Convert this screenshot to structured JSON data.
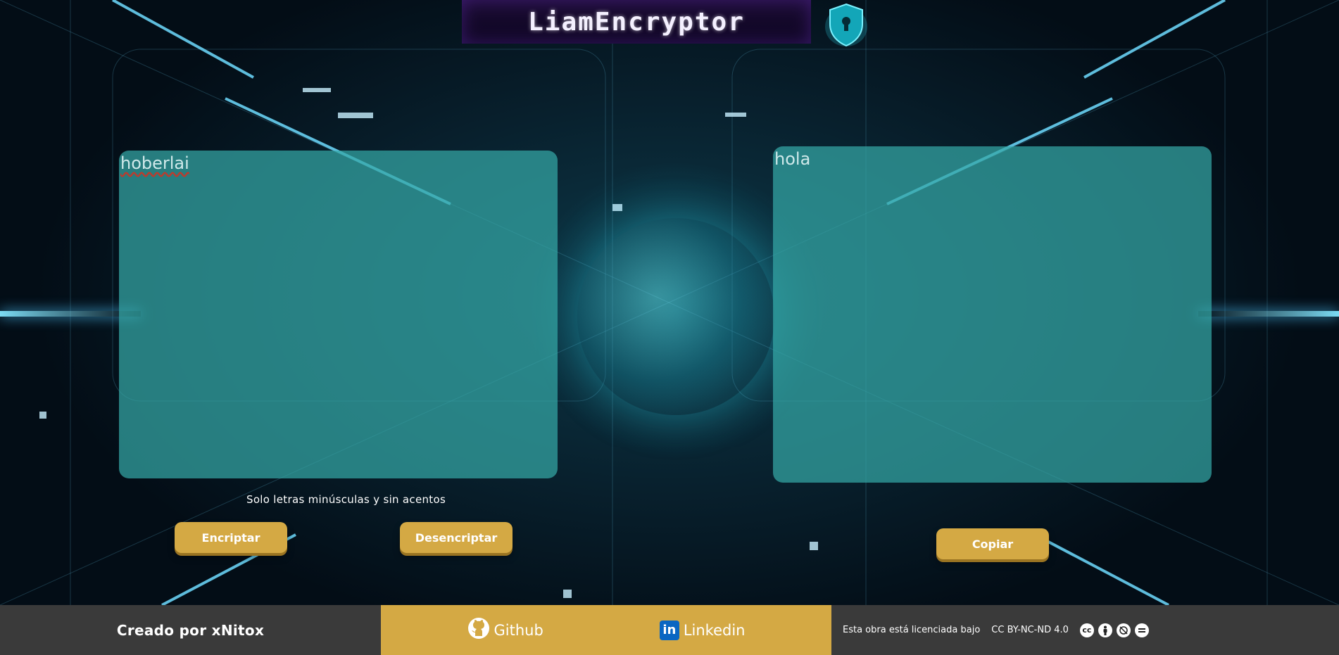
{
  "header": {
    "title": "LiamEncryptor",
    "logo_icon": "shield-lock-icon"
  },
  "input_panel": {
    "value": "hoberlai",
    "hint": "Solo letras minúsculas y sin acentos"
  },
  "output_panel": {
    "value": "hola"
  },
  "buttons": {
    "encrypt": "Encriptar",
    "decrypt": "Desencriptar",
    "copy": "Copiar"
  },
  "footer": {
    "credit": "Creado por xNitox",
    "github_label": "Github",
    "linkedin_label": "Linkedin",
    "license_text": "Esta obra está licenciada bajo",
    "license_name": "CC BY-NC-ND 4.0",
    "license_icons": [
      "cc-icon",
      "by-icon",
      "nc-icon",
      "nd-icon"
    ]
  },
  "colors": {
    "accent_gold": "#d4a944",
    "panel_teal": "#34a8a6",
    "footer_gray": "#3a3a3a"
  }
}
